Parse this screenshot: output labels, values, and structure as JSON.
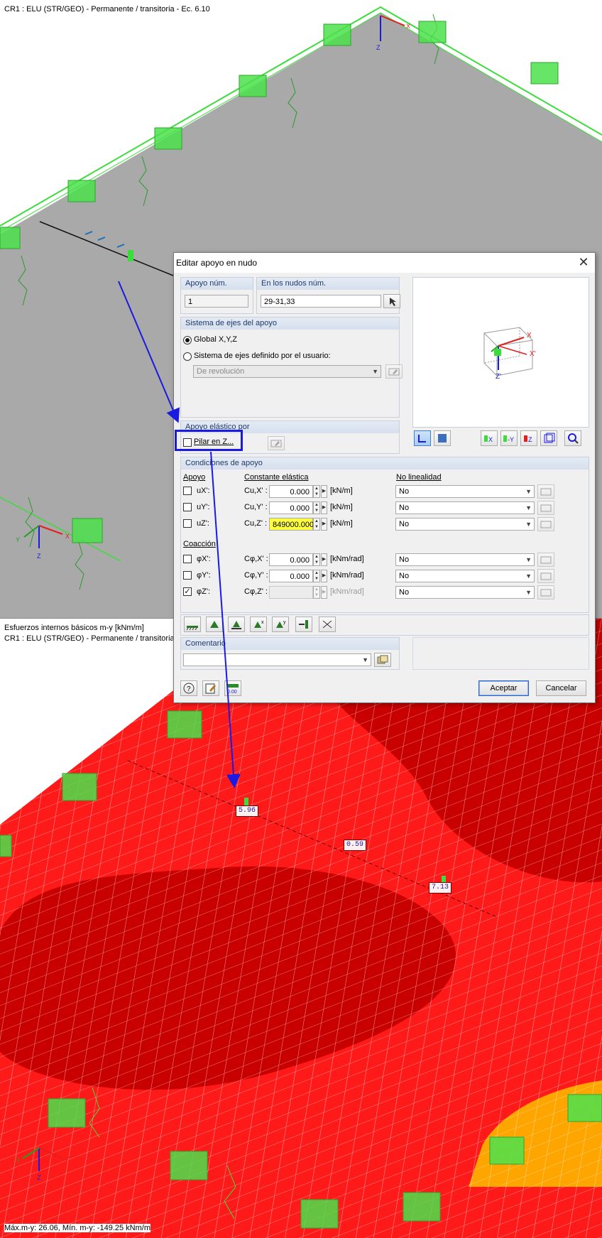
{
  "top_view": {
    "caption": "CR1 : ELU (STR/GEO) - Permanente / transitoria - Ec. 6.10"
  },
  "bottom_view": {
    "caption1": "Esfuerzos internos básicos m-y [kNm/m]",
    "caption2": "CR1 : ELU (STR/GEO) - Permanente / transitoria -",
    "footer": "Máx.m-y: 26.06, Mín. m-y: -149.25 kNm/m",
    "labels": [
      "5.96",
      "0.59",
      "7.13"
    ]
  },
  "axes": {
    "x": "X",
    "y": "Y",
    "z": "Z",
    "xp": "X'",
    "zp": "Z'"
  },
  "dialog": {
    "title": "Editar apoyo en nudo",
    "support_no_label": "Apoyo núm.",
    "support_no_value": "1",
    "nodes_label": "En los nudos núm.",
    "nodes_value": "29-31,33",
    "axis_system_head": "Sistema de ejes del apoyo",
    "global_label": "Global X,Y,Z",
    "user_label": "Sistema de ejes definido por el usuario:",
    "user_combo": "De revolución",
    "elastic_head": "Apoyo elástico por",
    "column_label": "Pilar en Z...",
    "conditions_head": "Condiciones de apoyo",
    "col_support": "Apoyo",
    "col_constant": "Constante elástica",
    "col_nonlinear": "No linealidad",
    "displacement_rows": [
      {
        "dof": "uX':",
        "const": "Cu,X' :",
        "value": "0.000",
        "unit": "[kN/m]",
        "nonlin": "No",
        "checked": false
      },
      {
        "dof": "uY':",
        "const": "Cu,Y' :",
        "value": "0.000",
        "unit": "[kN/m]",
        "nonlin": "No",
        "checked": false
      },
      {
        "dof": "uZ':",
        "const": "Cu,Z' :",
        "value": "849000.000",
        "unit": "[kN/m]",
        "nonlin": "No",
        "checked": false
      }
    ],
    "restraint_head": "Coacción",
    "rotation_rows": [
      {
        "dof": "φX':",
        "const": "Cφ,X' :",
        "value": "0.000",
        "unit": "[kNm/rad]",
        "nonlin": "No",
        "checked": false
      },
      {
        "dof": "φY':",
        "const": "Cφ,Y' :",
        "value": "0.000",
        "unit": "[kNm/rad]",
        "nonlin": "No",
        "checked": false
      },
      {
        "dof": "φZ':",
        "const": "Cφ,Z' :",
        "value": "",
        "unit": "[kNm/rad]",
        "nonlin": "No",
        "checked": true
      }
    ],
    "comment_head": "Comentario",
    "comment_value": "",
    "ok_label": "Aceptar",
    "cancel_label": "Cancelar"
  },
  "colors": {
    "slab_gray": "#a9a9a9",
    "result_red": "#ff1a1a",
    "result_dark": "#c80000",
    "result_orange": "#ffa500",
    "support_green": "#3cdc3c",
    "annotation_blue": "#1a1ae0",
    "highlight_yellow": "#ffff40"
  }
}
